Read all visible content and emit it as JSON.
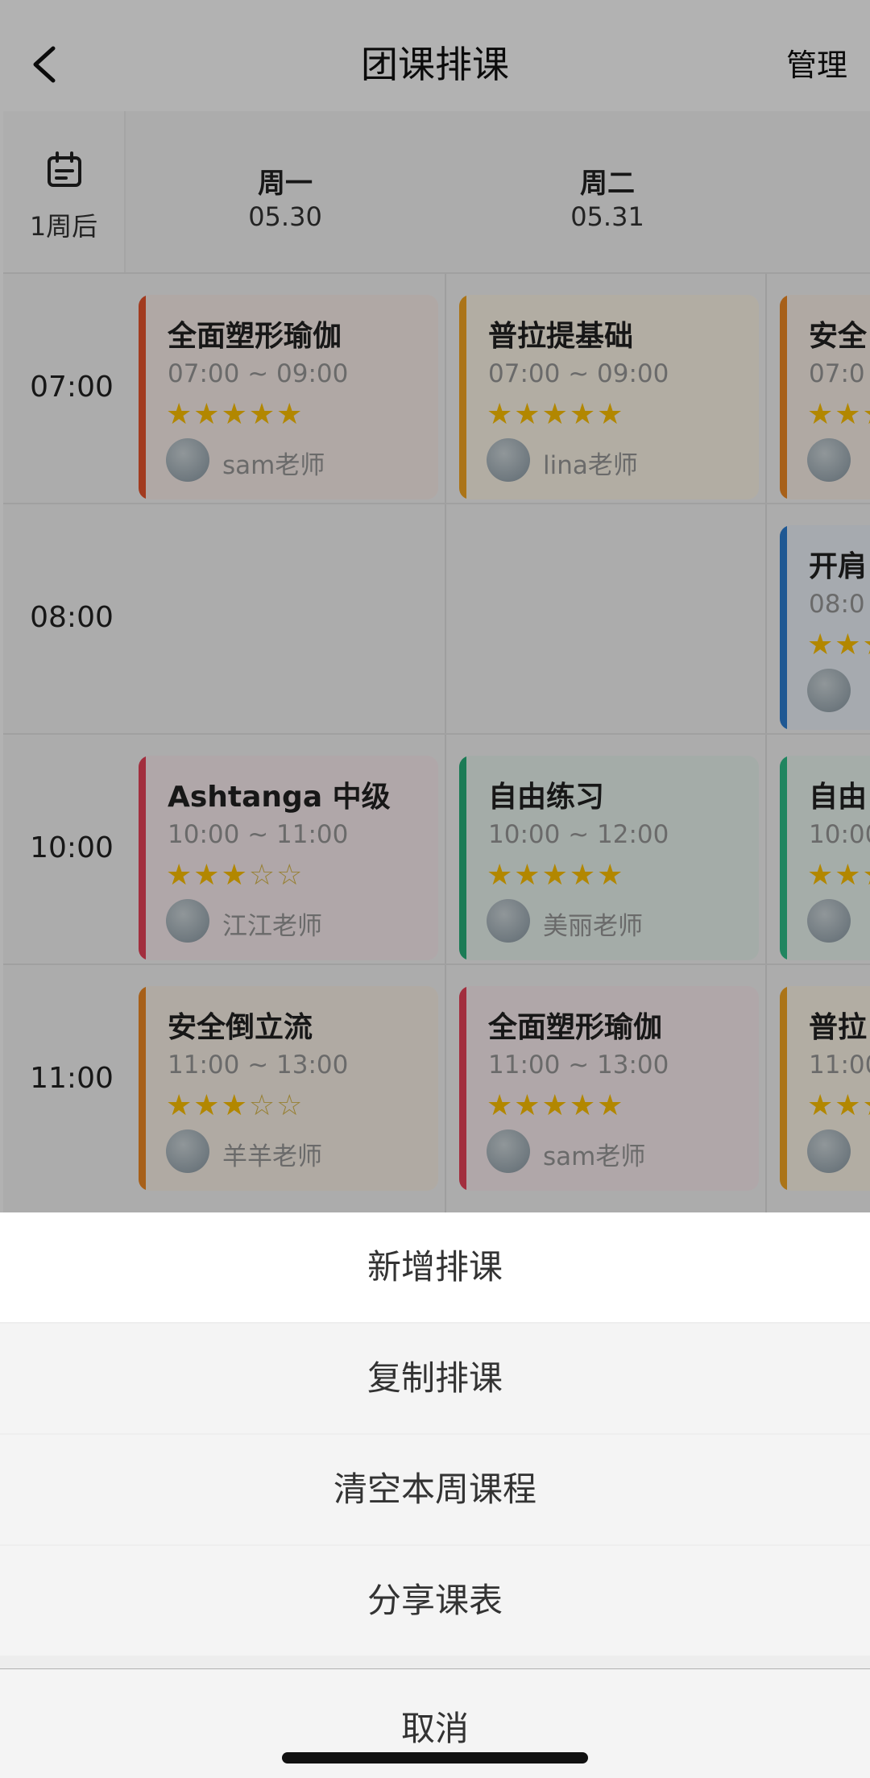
{
  "header": {
    "title": "团课排课",
    "manage_label": "管理"
  },
  "week_selector": {
    "label": "1周后"
  },
  "days": [
    {
      "name": "周一",
      "date": "05.30"
    },
    {
      "name": "周二",
      "date": "05.31"
    }
  ],
  "time_slots": [
    "07:00",
    "08:00",
    "10:00",
    "11:00"
  ],
  "courses": {
    "mon_0700": {
      "name": "全面塑形瑜伽",
      "time": "07:00 ~ 09:00",
      "rating": 5,
      "teacher": "sam老师",
      "color": "#e8552d"
    },
    "tue_0700": {
      "name": "普拉提基础",
      "time": "07:00 ~ 09:00",
      "rating": 5,
      "teacher": "lina老师",
      "color": "#f5a623"
    },
    "wed_0700": {
      "name": "安全",
      "time": "07:0",
      "rating": 5,
      "teacher": "",
      "color": "#f08a24"
    },
    "wed_0800": {
      "name": "开肩",
      "time": "08:0",
      "rating": 5,
      "teacher": "",
      "color": "#2d7fd3"
    },
    "mon_1000": {
      "name": "Ashtanga 中级",
      "time": "10:00 ~ 11:00",
      "rating": 3,
      "teacher": "江江老师",
      "color": "#e8435a"
    },
    "tue_1000": {
      "name": "自由练习",
      "time": "10:00 ~ 12:00",
      "rating": 5,
      "teacher": "美丽老师",
      "color": "#27b07a"
    },
    "wed_1000": {
      "name": "自由",
      "time": "10:00",
      "rating": 5,
      "teacher": "",
      "color": "#2fbf8a"
    },
    "mon_1100": {
      "name": "安全倒立流",
      "time": "11:00 ~ 13:00",
      "rating": 3,
      "teacher": "羊羊老师",
      "color": "#f08a24"
    },
    "tue_1100": {
      "name": "全面塑形瑜伽",
      "time": "11:00 ~ 13:00",
      "rating": 5,
      "teacher": "sam老师",
      "color": "#e8435a"
    },
    "wed_1100": {
      "name": "普拉",
      "time": "11:00",
      "rating": 5,
      "teacher": "",
      "color": "#f5a623"
    }
  },
  "action_sheet": {
    "add": "新增排课",
    "copy": "复制排课",
    "clear": "清空本周课程",
    "share": "分享课表",
    "cancel": "取消"
  },
  "icons": {
    "back": "chevron-left-icon",
    "calendar": "calendar-icon"
  }
}
